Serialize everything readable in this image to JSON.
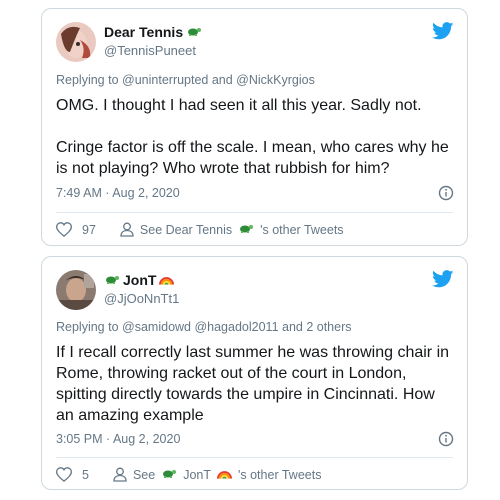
{
  "tweets": [
    {
      "display_name": "Dear Tennis",
      "name_emoji": "turtle-icon",
      "handle": "@TennisPuneet",
      "reply_prefix": "Replying to",
      "reply_mentions": "@uninterrupted and @NickKyrgios",
      "body_lines": [
        "OMG. I thought I had seen it all this year. Sadly not.",
        "",
        "Cringe factor is off the scale. I mean, who cares why he is not playing? Who wrote that rubbish for him?"
      ],
      "timestamp": "7:49 AM · Aug 2, 2020",
      "likes": "97",
      "see_prefix": "See Dear Tennis",
      "see_suffix": "'s other Tweets"
    },
    {
      "display_name": "JonT",
      "name_emoji": "turtle-rainbow-icon",
      "handle": "@JjOoNnTt1",
      "reply_prefix": "Replying to",
      "reply_mentions": "@samidowd @hagadol2011 and 2 others",
      "body_lines": [
        "If I recall correctly last summer he was throwing chair in Rome, throwing racket out of the court in London, spitting directly towards the umpire in Cincinnati. How an amazing example"
      ],
      "timestamp": "3:05 PM · Aug 2, 2020",
      "likes": "5",
      "see_prefix": "See",
      "see_name": "JonT",
      "see_suffix": "'s other Tweets"
    }
  ],
  "colors": {
    "twitter_blue": "#1da1f2",
    "secondary_text": "#657786",
    "border": "#cfd9de"
  }
}
